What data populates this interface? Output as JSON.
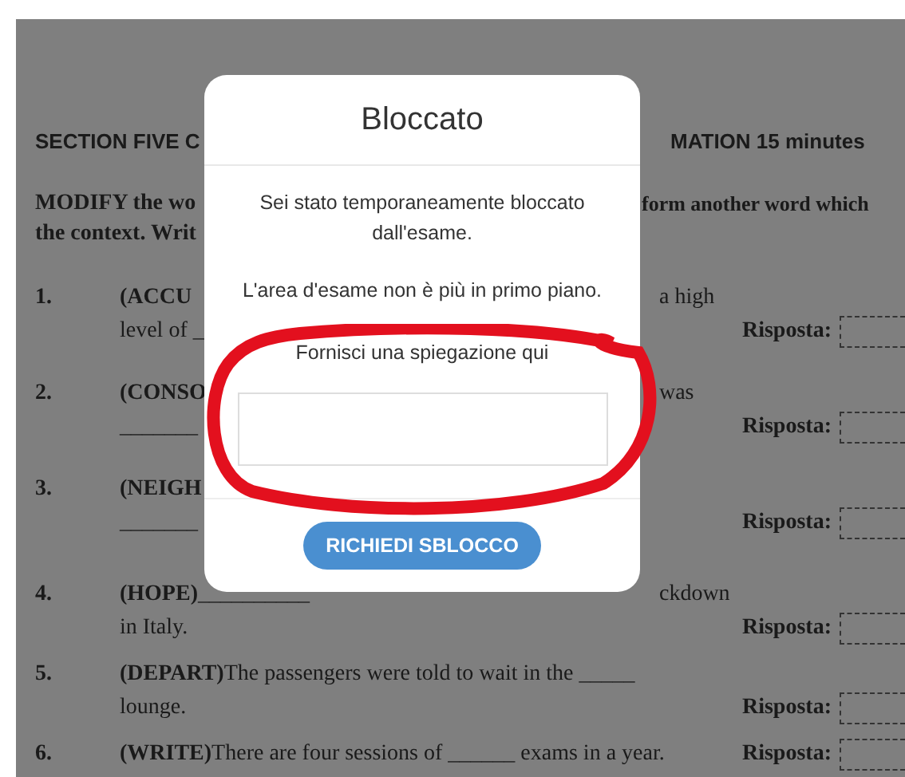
{
  "document": {
    "section_title_left": "SECTION FIVE C",
    "section_title_right": "MATION 15 minutes",
    "instructions": [
      {
        "left": "MODIFY the wo",
        "right": "form another word which"
      },
      {
        "left": "the context. Writ"
      }
    ],
    "items": [
      {
        "number": "1.",
        "keyword": "(ACCU",
        "right": "a high",
        "line2": "level of _",
        "answer_label": "Risposta:"
      },
      {
        "number": "2.",
        "keyword": "(CONSO",
        "right": "was",
        "line2": "_______",
        "answer_label": "Risposta:"
      },
      {
        "number": "3.",
        "keyword": "(NEIGH",
        "line2": "_______",
        "answer_label": "Risposta:"
      },
      {
        "number": "4.",
        "keyword": "(HOPE)",
        "text": "__________",
        "right": "ckdown",
        "line2": "in Italy.",
        "answer_label": "Risposta:"
      },
      {
        "number": "5.",
        "keyword": "(DEPART)",
        "text": "The passengers were told to wait in the _____",
        "line2": "lounge.",
        "answer_label": "Risposta:"
      },
      {
        "number": "6.",
        "keyword": "(WRITE)",
        "text": "There are four sessions of ______ exams in a year.",
        "answer_label": "Risposta:"
      }
    ]
  },
  "modal": {
    "title": "Bloccato",
    "message": "Sei stato temporaneamente bloccato dall'esame.",
    "reason": "L'area d'esame non è più in primo piano.",
    "prompt": "Fornisci una spiegazione qui",
    "button": "RICHIEDI SBLOCCO"
  }
}
